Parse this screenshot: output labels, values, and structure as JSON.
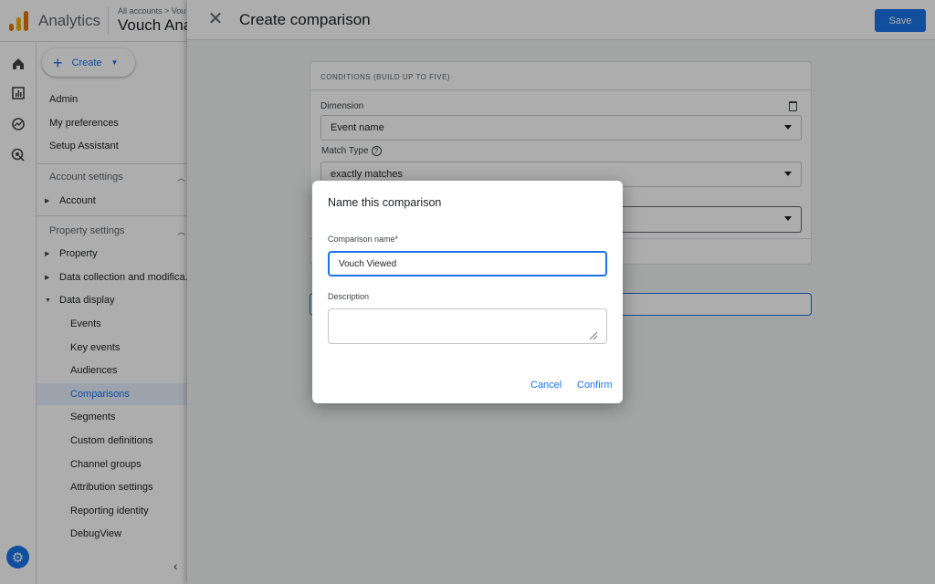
{
  "app": {
    "product_title": "Analytics",
    "breadcrumb": "All accounts > Vou",
    "account_name": "Vouch Analytics"
  },
  "nav": {
    "create_label": "Create",
    "top_items": [
      {
        "label": "Admin"
      },
      {
        "label": "My preferences"
      },
      {
        "label": "Setup Assistant"
      }
    ],
    "account_settings": {
      "label": "Account settings",
      "items": [
        {
          "label": "Account"
        }
      ]
    },
    "property_settings": {
      "label": "Property settings",
      "items": [
        {
          "label": "Property"
        },
        {
          "label": "Data collection and modifica..."
        },
        {
          "label": "Data display"
        }
      ]
    },
    "data_display_items": [
      {
        "label": "Events"
      },
      {
        "label": "Key events"
      },
      {
        "label": "Audiences"
      },
      {
        "label": "Comparisons",
        "active": true
      },
      {
        "label": "Segments"
      },
      {
        "label": "Custom definitions"
      },
      {
        "label": "Channel groups"
      },
      {
        "label": "Attribution settings"
      },
      {
        "label": "Reporting identity"
      },
      {
        "label": "DebugView"
      }
    ]
  },
  "panel": {
    "title": "Create comparison",
    "save_label": "Save",
    "conditions_header": "CONDITIONS (BUILD UP TO FIVE)",
    "dimension_label": "Dimension",
    "dimension_value": "Event name",
    "match_type_label": "Match Type",
    "match_type_value": "exactly matches"
  },
  "dialog": {
    "title": "Name this comparison",
    "name_label": "Comparison name*",
    "name_value": "Vouch Viewed",
    "description_label": "Description",
    "description_value": "",
    "cancel_label": "Cancel",
    "confirm_label": "Confirm"
  },
  "colors": {
    "accent": "#1a73e8",
    "scrim": "rgba(0,0,0,0.32)"
  }
}
